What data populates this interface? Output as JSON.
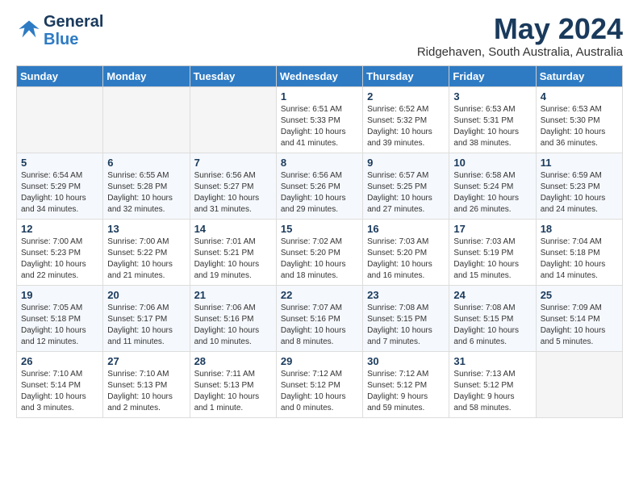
{
  "logo": {
    "line1": "General",
    "line2": "Blue"
  },
  "title": "May 2024",
  "subtitle": "Ridgehaven, South Australia, Australia",
  "days_header": [
    "Sunday",
    "Monday",
    "Tuesday",
    "Wednesday",
    "Thursday",
    "Friday",
    "Saturday"
  ],
  "weeks": [
    [
      {
        "num": "",
        "info": ""
      },
      {
        "num": "",
        "info": ""
      },
      {
        "num": "",
        "info": ""
      },
      {
        "num": "1",
        "info": "Sunrise: 6:51 AM\nSunset: 5:33 PM\nDaylight: 10 hours\nand 41 minutes."
      },
      {
        "num": "2",
        "info": "Sunrise: 6:52 AM\nSunset: 5:32 PM\nDaylight: 10 hours\nand 39 minutes."
      },
      {
        "num": "3",
        "info": "Sunrise: 6:53 AM\nSunset: 5:31 PM\nDaylight: 10 hours\nand 38 minutes."
      },
      {
        "num": "4",
        "info": "Sunrise: 6:53 AM\nSunset: 5:30 PM\nDaylight: 10 hours\nand 36 minutes."
      }
    ],
    [
      {
        "num": "5",
        "info": "Sunrise: 6:54 AM\nSunset: 5:29 PM\nDaylight: 10 hours\nand 34 minutes."
      },
      {
        "num": "6",
        "info": "Sunrise: 6:55 AM\nSunset: 5:28 PM\nDaylight: 10 hours\nand 32 minutes."
      },
      {
        "num": "7",
        "info": "Sunrise: 6:56 AM\nSunset: 5:27 PM\nDaylight: 10 hours\nand 31 minutes."
      },
      {
        "num": "8",
        "info": "Sunrise: 6:56 AM\nSunset: 5:26 PM\nDaylight: 10 hours\nand 29 minutes."
      },
      {
        "num": "9",
        "info": "Sunrise: 6:57 AM\nSunset: 5:25 PM\nDaylight: 10 hours\nand 27 minutes."
      },
      {
        "num": "10",
        "info": "Sunrise: 6:58 AM\nSunset: 5:24 PM\nDaylight: 10 hours\nand 26 minutes."
      },
      {
        "num": "11",
        "info": "Sunrise: 6:59 AM\nSunset: 5:23 PM\nDaylight: 10 hours\nand 24 minutes."
      }
    ],
    [
      {
        "num": "12",
        "info": "Sunrise: 7:00 AM\nSunset: 5:23 PM\nDaylight: 10 hours\nand 22 minutes."
      },
      {
        "num": "13",
        "info": "Sunrise: 7:00 AM\nSunset: 5:22 PM\nDaylight: 10 hours\nand 21 minutes."
      },
      {
        "num": "14",
        "info": "Sunrise: 7:01 AM\nSunset: 5:21 PM\nDaylight: 10 hours\nand 19 minutes."
      },
      {
        "num": "15",
        "info": "Sunrise: 7:02 AM\nSunset: 5:20 PM\nDaylight: 10 hours\nand 18 minutes."
      },
      {
        "num": "16",
        "info": "Sunrise: 7:03 AM\nSunset: 5:20 PM\nDaylight: 10 hours\nand 16 minutes."
      },
      {
        "num": "17",
        "info": "Sunrise: 7:03 AM\nSunset: 5:19 PM\nDaylight: 10 hours\nand 15 minutes."
      },
      {
        "num": "18",
        "info": "Sunrise: 7:04 AM\nSunset: 5:18 PM\nDaylight: 10 hours\nand 14 minutes."
      }
    ],
    [
      {
        "num": "19",
        "info": "Sunrise: 7:05 AM\nSunset: 5:18 PM\nDaylight: 10 hours\nand 12 minutes."
      },
      {
        "num": "20",
        "info": "Sunrise: 7:06 AM\nSunset: 5:17 PM\nDaylight: 10 hours\nand 11 minutes."
      },
      {
        "num": "21",
        "info": "Sunrise: 7:06 AM\nSunset: 5:16 PM\nDaylight: 10 hours\nand 10 minutes."
      },
      {
        "num": "22",
        "info": "Sunrise: 7:07 AM\nSunset: 5:16 PM\nDaylight: 10 hours\nand 8 minutes."
      },
      {
        "num": "23",
        "info": "Sunrise: 7:08 AM\nSunset: 5:15 PM\nDaylight: 10 hours\nand 7 minutes."
      },
      {
        "num": "24",
        "info": "Sunrise: 7:08 AM\nSunset: 5:15 PM\nDaylight: 10 hours\nand 6 minutes."
      },
      {
        "num": "25",
        "info": "Sunrise: 7:09 AM\nSunset: 5:14 PM\nDaylight: 10 hours\nand 5 minutes."
      }
    ],
    [
      {
        "num": "26",
        "info": "Sunrise: 7:10 AM\nSunset: 5:14 PM\nDaylight: 10 hours\nand 3 minutes."
      },
      {
        "num": "27",
        "info": "Sunrise: 7:10 AM\nSunset: 5:13 PM\nDaylight: 10 hours\nand 2 minutes."
      },
      {
        "num": "28",
        "info": "Sunrise: 7:11 AM\nSunset: 5:13 PM\nDaylight: 10 hours\nand 1 minute."
      },
      {
        "num": "29",
        "info": "Sunrise: 7:12 AM\nSunset: 5:12 PM\nDaylight: 10 hours\nand 0 minutes."
      },
      {
        "num": "30",
        "info": "Sunrise: 7:12 AM\nSunset: 5:12 PM\nDaylight: 9 hours\nand 59 minutes."
      },
      {
        "num": "31",
        "info": "Sunrise: 7:13 AM\nSunset: 5:12 PM\nDaylight: 9 hours\nand 58 minutes."
      },
      {
        "num": "",
        "info": ""
      }
    ]
  ]
}
